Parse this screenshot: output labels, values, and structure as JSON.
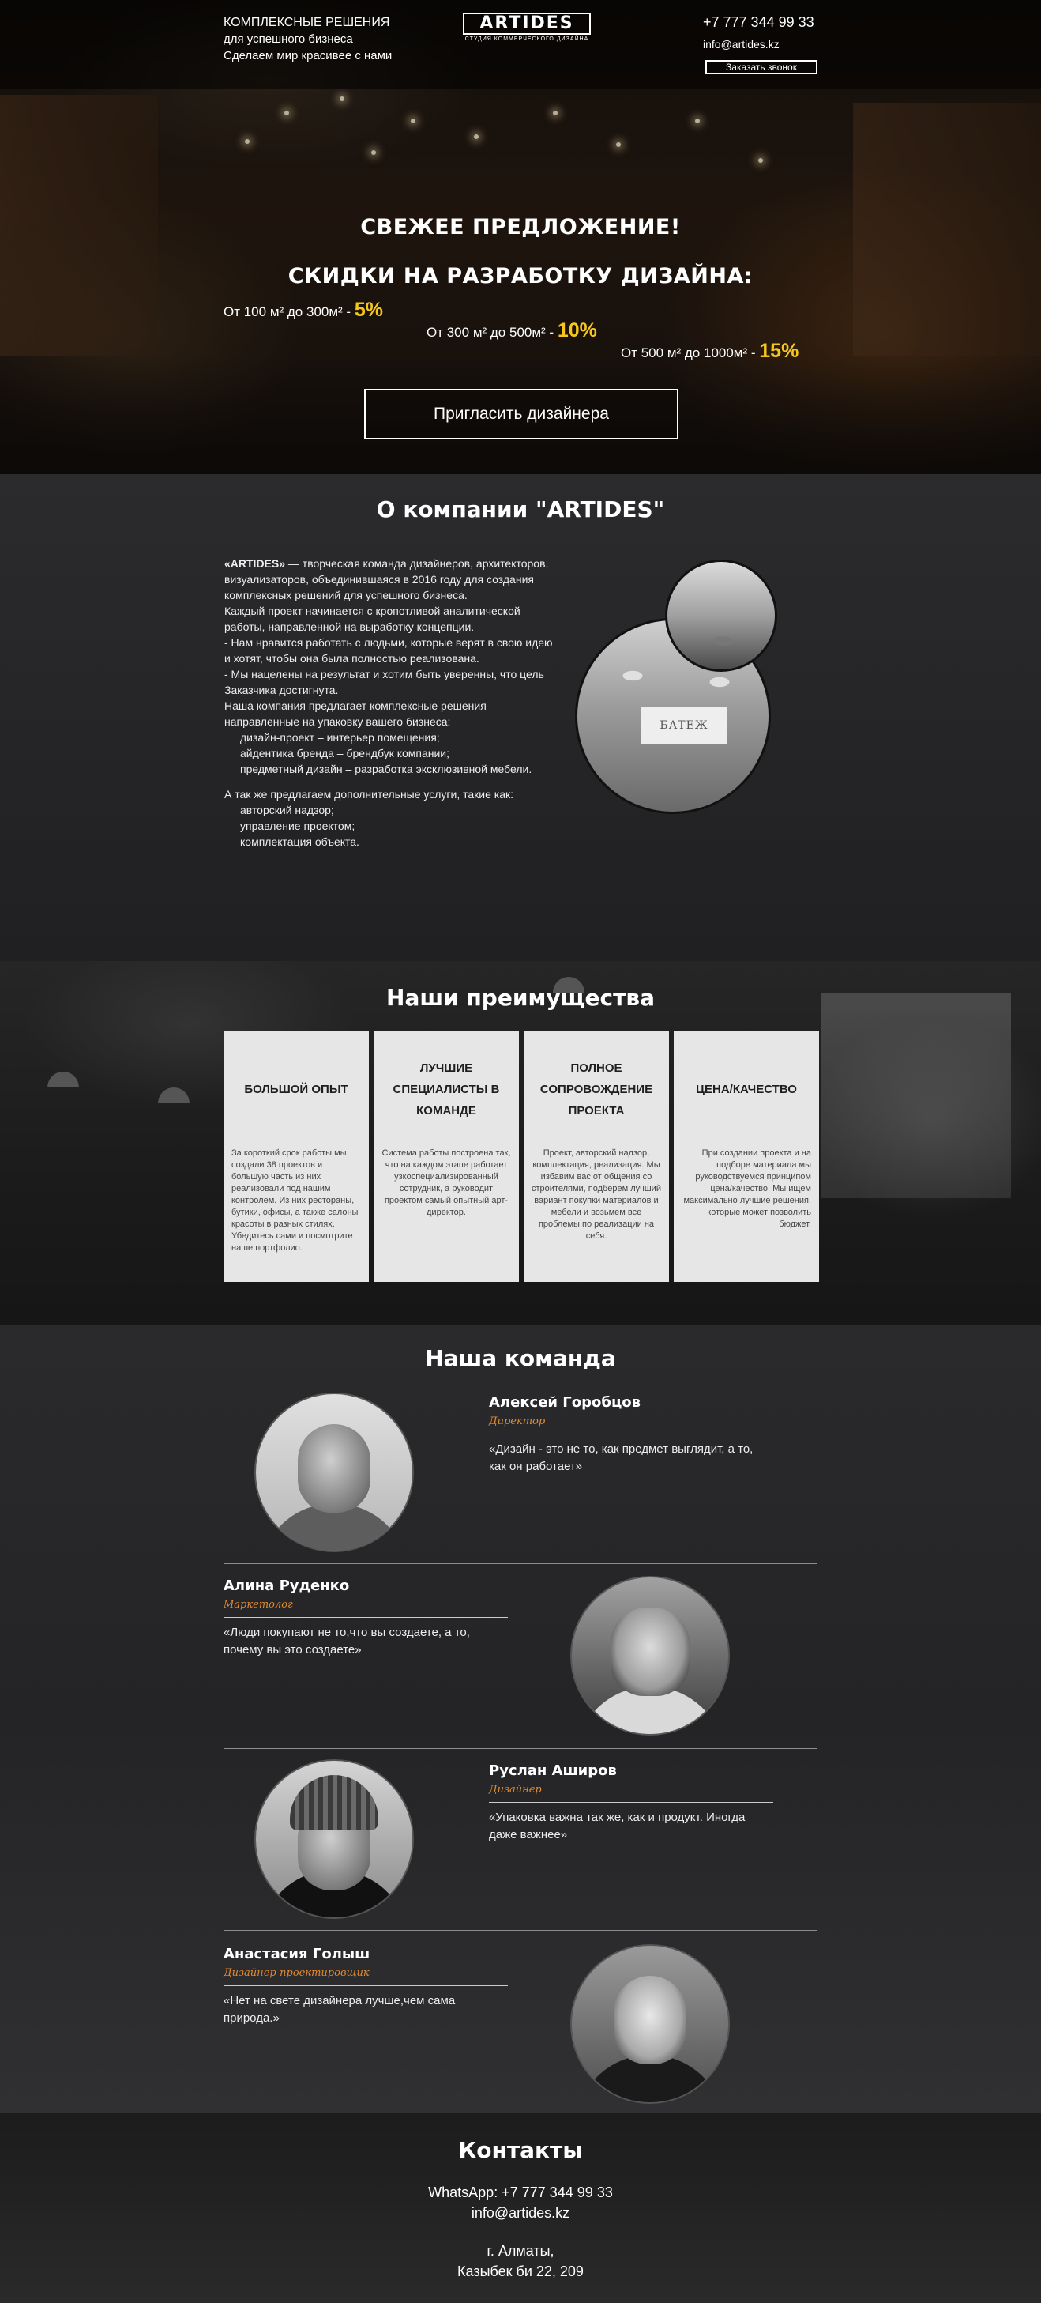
{
  "header": {
    "tagline_line1": "КОМПЛЕКСНЫЕ РЕШЕНИЯ",
    "tagline_line2": "для успешного бизнеса",
    "tagline_line3": "Сделаем мир красивее с нами",
    "logo_word": "ARTIDES",
    "logo_sub": "СТУДИЯ КОММЕРЧЕСКОГО ДИЗАЙНА",
    "phone": "+7 777 344 99 33",
    "email": "info@artides.kz",
    "callback_button": "Заказать звонок"
  },
  "offer": {
    "headline": "СВЕЖЕЕ ПРЕДЛОЖЕНИЕ!",
    "subheadline": "СКИДКИ НА РАЗРАБОТКУ ДИЗАЙНА:",
    "discounts": [
      {
        "range": "От 100 м² до 300м² -",
        "percent": "5%"
      },
      {
        "range": "От 300 м² до 500м² -",
        "percent": "10%"
      },
      {
        "range": "От 500 м² до 1000м² -",
        "percent": "15%"
      }
    ],
    "cta_button": "Пригласить дизайнера"
  },
  "about": {
    "title": "О компании \"ARTIDES\"",
    "brand": "«ARTIDES»",
    "intro": " — творческая команда дизайнеров, архитекторов, визуализаторов, объединившаяся в 2016 году для создания комплексных решений для успешного бизнеса.",
    "p1": "Каждый проект начинается с кропотливой аналитической",
    "p2": "работы, направленной на выработку концепции.",
    "p3": "- Нам нравится работать с людьми, которые верят в свою идею и хотят, чтобы она была полностью реализована.",
    "p4": "- Мы нацелены на результат и хотим быть уверенны, что цель Заказчика достигнута.",
    "p5": "Наша компания предлагает комплексные решения направленные на упаковку вашего бизнеса:",
    "services": [
      "дизайн-проект – интерьер помещения;",
      "айдентика бренда – брендбук компании;",
      "предметный дизайн – разработка эксклюзивной мебели."
    ],
    "extra_intro": "А так же предлагаем дополнительные услуги, такие как:",
    "extra": [
      "авторский надзор;",
      "управление проектом;",
      "комплектация объекта."
    ],
    "photo_sign": "БАТЕЖ"
  },
  "advantages": {
    "title": "Наши преимущества",
    "cards": [
      {
        "title": "БОЛЬШОЙ ОПЫТ",
        "text": "За короткий срок работы мы создали 38 проектов и большую часть из них реализовали под нашим контролем. Из них рестораны, бутики, офисы, а также салоны красоты в разных стилях. Убедитесь сами и посмотрите наше портфолио."
      },
      {
        "title": "ЛУЧШИЕ СПЕЦИАЛИСТЫ В КОМАНДЕ",
        "text": "Система работы построена так, что на каждом этапе работает узкоспециализированный сотрудник, а руководит проектом самый опытный арт-директор."
      },
      {
        "title": "ПОЛНОЕ СОПРОВОЖДЕНИЕ ПРОЕКТА",
        "text": "Проект, авторский надзор, комплектация, реализация. Мы избавим вас от общения со строителями, подберем лучший вариант покупки материалов и мебели и возьмем все проблемы по реализации на себя."
      },
      {
        "title": "ЦЕНА/КАЧЕСТВО",
        "text": "При создании проекта и на подборе материала мы руководствуемся принципом цена/качество. Мы ищем максимально лучшие решения, которые может позволить бюджет."
      }
    ]
  },
  "team": {
    "title": "Наша команда",
    "members": [
      {
        "name": "Алексей Горобцов",
        "role": "Директор",
        "quote": "«Дизайн - это не то, как предмет выглядит, а то, как он работает»"
      },
      {
        "name": "Алина Руденко",
        "role": "Маркетолог",
        "quote": "«Люди покупают не то,что вы создаете, а то, почему вы это создаете»"
      },
      {
        "name": "Руслан Аширов",
        "role": "Дизайнер",
        "quote": "«Упаковка важна так же, как и продукт. Иногда даже важнее»"
      },
      {
        "name": "Анастасия Голыш",
        "role": "Дизайнер-проектировщик",
        "quote": "«Нет на свете дизайнера лучше,чем сама природа.»"
      }
    ]
  },
  "contacts": {
    "title": "Контакты",
    "whatsapp_label": "WhatsApp: ",
    "whatsapp": "+7 777 344 99 33",
    "email": "info@artides.kz",
    "city": "г. Алматы,",
    "address": "Казыбек би 22, 209"
  },
  "colors": {
    "accent_yellow": "#f6c61c",
    "role_orange": "#e38a2f",
    "card_bg": "#e6e6e6"
  }
}
